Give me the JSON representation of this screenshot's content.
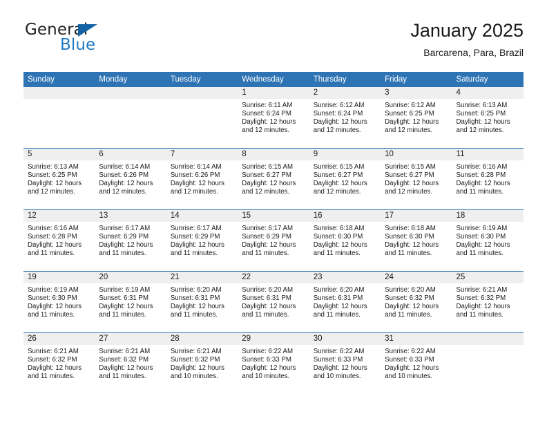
{
  "brand": {
    "name_top": "General",
    "name_bottom": "Blue",
    "triangle_icon": "brand-triangle-icon",
    "color_dark": "#231f20",
    "color_blue": "#1f7ac4",
    "color_triangle": "#1464a5"
  },
  "header": {
    "title": "January 2025",
    "subtitle": "Barcarena, Para, Brazil"
  },
  "theme": {
    "header_bg": "#2e74b5",
    "daynum_bg": "#efefef",
    "separator": "#2e74b5",
    "text": "#1a1a1a"
  },
  "columns": [
    "Sunday",
    "Monday",
    "Tuesday",
    "Wednesday",
    "Thursday",
    "Friday",
    "Saturday"
  ],
  "weeks": [
    [
      {
        "day": "",
        "lines": []
      },
      {
        "day": "",
        "lines": []
      },
      {
        "day": "",
        "lines": []
      },
      {
        "day": "1",
        "lines": [
          "Sunrise: 6:11 AM",
          "Sunset: 6:24 PM",
          "Daylight: 12 hours",
          "and 12 minutes."
        ]
      },
      {
        "day": "2",
        "lines": [
          "Sunrise: 6:12 AM",
          "Sunset: 6:24 PM",
          "Daylight: 12 hours",
          "and 12 minutes."
        ]
      },
      {
        "day": "3",
        "lines": [
          "Sunrise: 6:12 AM",
          "Sunset: 6:25 PM",
          "Daylight: 12 hours",
          "and 12 minutes."
        ]
      },
      {
        "day": "4",
        "lines": [
          "Sunrise: 6:13 AM",
          "Sunset: 6:25 PM",
          "Daylight: 12 hours",
          "and 12 minutes."
        ]
      }
    ],
    [
      {
        "day": "5",
        "lines": [
          "Sunrise: 6:13 AM",
          "Sunset: 6:25 PM",
          "Daylight: 12 hours",
          "and 12 minutes."
        ]
      },
      {
        "day": "6",
        "lines": [
          "Sunrise: 6:14 AM",
          "Sunset: 6:26 PM",
          "Daylight: 12 hours",
          "and 12 minutes."
        ]
      },
      {
        "day": "7",
        "lines": [
          "Sunrise: 6:14 AM",
          "Sunset: 6:26 PM",
          "Daylight: 12 hours",
          "and 12 minutes."
        ]
      },
      {
        "day": "8",
        "lines": [
          "Sunrise: 6:15 AM",
          "Sunset: 6:27 PM",
          "Daylight: 12 hours",
          "and 12 minutes."
        ]
      },
      {
        "day": "9",
        "lines": [
          "Sunrise: 6:15 AM",
          "Sunset: 6:27 PM",
          "Daylight: 12 hours",
          "and 12 minutes."
        ]
      },
      {
        "day": "10",
        "lines": [
          "Sunrise: 6:15 AM",
          "Sunset: 6:27 PM",
          "Daylight: 12 hours",
          "and 12 minutes."
        ]
      },
      {
        "day": "11",
        "lines": [
          "Sunrise: 6:16 AM",
          "Sunset: 6:28 PM",
          "Daylight: 12 hours",
          "and 11 minutes."
        ]
      }
    ],
    [
      {
        "day": "12",
        "lines": [
          "Sunrise: 6:16 AM",
          "Sunset: 6:28 PM",
          "Daylight: 12 hours",
          "and 11 minutes."
        ]
      },
      {
        "day": "13",
        "lines": [
          "Sunrise: 6:17 AM",
          "Sunset: 6:29 PM",
          "Daylight: 12 hours",
          "and 11 minutes."
        ]
      },
      {
        "day": "14",
        "lines": [
          "Sunrise: 6:17 AM",
          "Sunset: 6:29 PM",
          "Daylight: 12 hours",
          "and 11 minutes."
        ]
      },
      {
        "day": "15",
        "lines": [
          "Sunrise: 6:17 AM",
          "Sunset: 6:29 PM",
          "Daylight: 12 hours",
          "and 11 minutes."
        ]
      },
      {
        "day": "16",
        "lines": [
          "Sunrise: 6:18 AM",
          "Sunset: 6:30 PM",
          "Daylight: 12 hours",
          "and 11 minutes."
        ]
      },
      {
        "day": "17",
        "lines": [
          "Sunrise: 6:18 AM",
          "Sunset: 6:30 PM",
          "Daylight: 12 hours",
          "and 11 minutes."
        ]
      },
      {
        "day": "18",
        "lines": [
          "Sunrise: 6:19 AM",
          "Sunset: 6:30 PM",
          "Daylight: 12 hours",
          "and 11 minutes."
        ]
      }
    ],
    [
      {
        "day": "19",
        "lines": [
          "Sunrise: 6:19 AM",
          "Sunset: 6:30 PM",
          "Daylight: 12 hours",
          "and 11 minutes."
        ]
      },
      {
        "day": "20",
        "lines": [
          "Sunrise: 6:19 AM",
          "Sunset: 6:31 PM",
          "Daylight: 12 hours",
          "and 11 minutes."
        ]
      },
      {
        "day": "21",
        "lines": [
          "Sunrise: 6:20 AM",
          "Sunset: 6:31 PM",
          "Daylight: 12 hours",
          "and 11 minutes."
        ]
      },
      {
        "day": "22",
        "lines": [
          "Sunrise: 6:20 AM",
          "Sunset: 6:31 PM",
          "Daylight: 12 hours",
          "and 11 minutes."
        ]
      },
      {
        "day": "23",
        "lines": [
          "Sunrise: 6:20 AM",
          "Sunset: 6:31 PM",
          "Daylight: 12 hours",
          "and 11 minutes."
        ]
      },
      {
        "day": "24",
        "lines": [
          "Sunrise: 6:20 AM",
          "Sunset: 6:32 PM",
          "Daylight: 12 hours",
          "and 11 minutes."
        ]
      },
      {
        "day": "25",
        "lines": [
          "Sunrise: 6:21 AM",
          "Sunset: 6:32 PM",
          "Daylight: 12 hours",
          "and 11 minutes."
        ]
      }
    ],
    [
      {
        "day": "26",
        "lines": [
          "Sunrise: 6:21 AM",
          "Sunset: 6:32 PM",
          "Daylight: 12 hours",
          "and 11 minutes."
        ]
      },
      {
        "day": "27",
        "lines": [
          "Sunrise: 6:21 AM",
          "Sunset: 6:32 PM",
          "Daylight: 12 hours",
          "and 11 minutes."
        ]
      },
      {
        "day": "28",
        "lines": [
          "Sunrise: 6:21 AM",
          "Sunset: 6:32 PM",
          "Daylight: 12 hours",
          "and 10 minutes."
        ]
      },
      {
        "day": "29",
        "lines": [
          "Sunrise: 6:22 AM",
          "Sunset: 6:33 PM",
          "Daylight: 12 hours",
          "and 10 minutes."
        ]
      },
      {
        "day": "30",
        "lines": [
          "Sunrise: 6:22 AM",
          "Sunset: 6:33 PM",
          "Daylight: 12 hours",
          "and 10 minutes."
        ]
      },
      {
        "day": "31",
        "lines": [
          "Sunrise: 6:22 AM",
          "Sunset: 6:33 PM",
          "Daylight: 12 hours",
          "and 10 minutes."
        ]
      },
      {
        "day": "",
        "lines": []
      }
    ]
  ]
}
